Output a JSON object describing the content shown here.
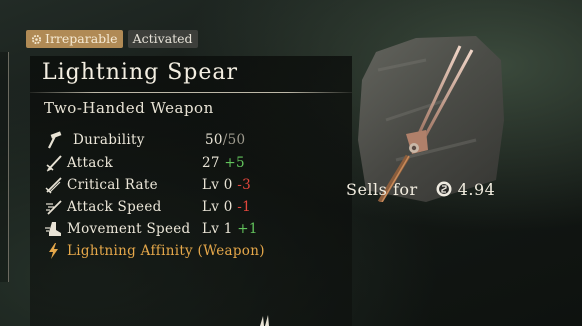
{
  "badges": {
    "irreparable": "Irreparable",
    "activated": "Activated"
  },
  "item": {
    "name": "Lightning Spear",
    "type": "Two-Handed Weapon"
  },
  "stats": {
    "durability": {
      "label": "Durability",
      "current": "50",
      "sep": "/",
      "max": "50"
    },
    "attack": {
      "label": "Attack",
      "value": "27",
      "delta": "+5"
    },
    "critical_rate": {
      "label": "Critical Rate",
      "value": "Lv 0",
      "delta": "-3"
    },
    "attack_speed": {
      "label": "Attack Speed",
      "value": "Lv 0",
      "delta": "-1"
    },
    "movement_speed": {
      "label": "Movement Speed",
      "value": "Lv 1",
      "delta": "+1"
    },
    "affinity": {
      "label": "Lightning Affinity (Weapon)"
    }
  },
  "sell": {
    "label": "Sells for",
    "value": "4.94"
  },
  "colors": {
    "positive": "#62c45c",
    "negative": "#e3463d",
    "affinity": "#e6a84a",
    "badge_irreparable": "#b08a55",
    "badge_activated": "#3d3f3b"
  }
}
